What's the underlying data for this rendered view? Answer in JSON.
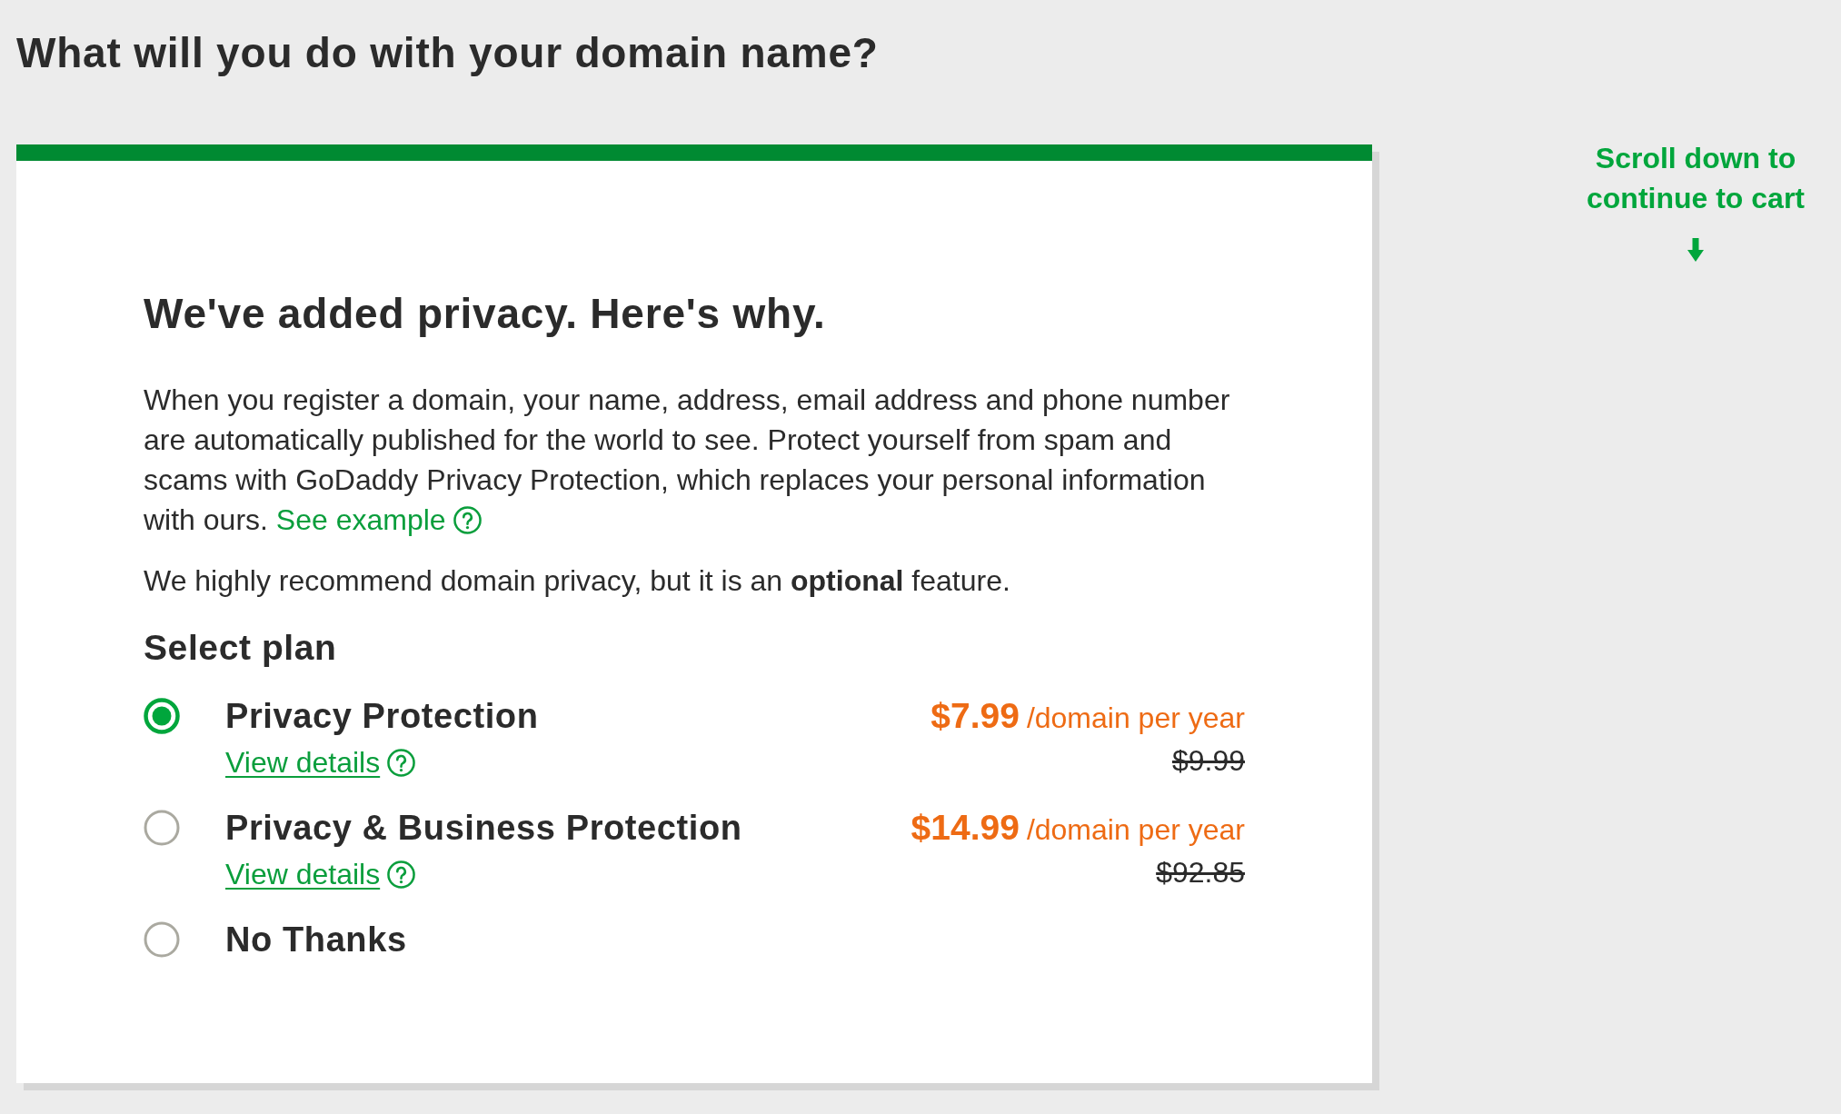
{
  "page_title": "What will you do with your domain name?",
  "privacy_card": {
    "title": "We've added privacy. Here's why.",
    "description": {
      "text": "When you register a domain, your name, address, email address and phone number are automatically published for the world to see. Protect yourself from spam and scams with GoDaddy Privacy Protection, which replaces your personal information with ours.",
      "link": "See example"
    },
    "note": "We highly recommend domain privacy, but it is an **optional** feature.",
    "plan_heading": "Select plan",
    "plans": [
      {
        "name": "Privacy Protection",
        "selected": true,
        "details_link": "View details",
        "price": "$7.99",
        "price_unit": "/domain per year",
        "original_price": "$9.99"
      },
      {
        "name": "Privacy & Business Protection",
        "selected": false,
        "details_link": "View details",
        "price": "$14.99",
        "price_unit": "/domain per year",
        "original_price": "$92.85"
      },
      {
        "name": "No Thanks",
        "selected": false
      }
    ]
  },
  "scroll_hint": "Scroll down to continue to cart"
}
